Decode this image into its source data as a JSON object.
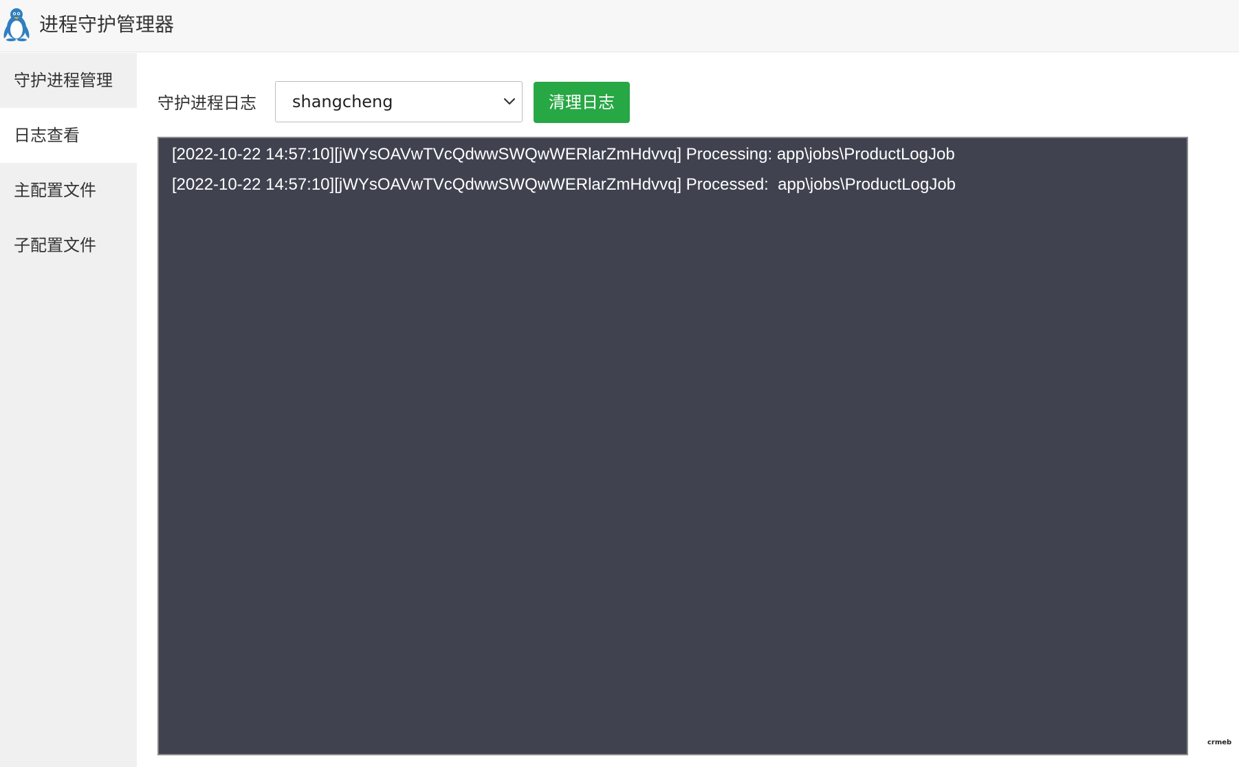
{
  "app": {
    "title": "进程守护管理器",
    "icon": "penguin-icon"
  },
  "sidebar": {
    "active_index": 1,
    "items": [
      {
        "label": "守护进程管理"
      },
      {
        "label": "日志查看"
      },
      {
        "label": "主配置文件"
      },
      {
        "label": "子配置文件"
      }
    ]
  },
  "main": {
    "field_label": "守护进程日志",
    "select": {
      "value": "shangcheng",
      "icon": "chevron-down-icon"
    },
    "clear_button_label": "清理日志",
    "log_lines": [
      "[2022-10-22 14:57:10][jWYsOAVwTVcQdwwSWQwWERlarZmHdvvq] Processing: app\\jobs\\ProductLogJob",
      "[2022-10-22 14:57:10][jWYsOAVwTVcQdwwSWQwWERlarZmHdvvq] Processed:  app\\jobs\\ProductLogJob"
    ]
  },
  "corner_logo": "crmeb",
  "colors": {
    "titlebar_bg": "#f7f7f7",
    "sidebar_bg": "#f0f0f0",
    "active_item_bg": "#ffffff",
    "button_green": "#28a745",
    "log_bg": "#40424f",
    "log_text": "#ffffff"
  }
}
